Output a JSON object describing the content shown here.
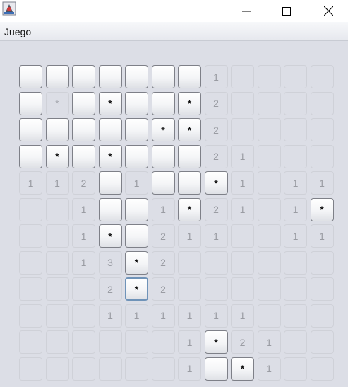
{
  "window": {
    "icon": "minesweeper-app-icon",
    "controls": {
      "minimize_icon": "minimize-icon",
      "maximize_icon": "maximize-icon",
      "close_icon": "close-icon"
    }
  },
  "menu": {
    "items": [
      {
        "label": "Juego"
      }
    ]
  },
  "board": {
    "rows": 12,
    "cols": 12,
    "focused_cell": [
      8,
      4
    ],
    "grid": [
      [
        "B",
        "B",
        "B",
        "B",
        "B",
        "B",
        "B",
        "1",
        "",
        "",
        "",
        ""
      ],
      [
        "B",
        "o*",
        "B",
        "B*",
        "B",
        "B",
        "B*",
        "2",
        "",
        "",
        "",
        ""
      ],
      [
        "B",
        "B",
        "B",
        "B",
        "B",
        "B*",
        "B*",
        "2",
        "",
        "",
        "",
        ""
      ],
      [
        "B",
        "B*",
        "B",
        "B*",
        "B",
        "B",
        "B",
        "2",
        "1",
        "",
        "",
        ""
      ],
      [
        "1",
        "1",
        "2",
        "B",
        "1",
        "B",
        "B",
        "B*",
        "1",
        "",
        "1",
        "1"
      ],
      [
        "",
        "",
        "1",
        "B",
        "B",
        "1",
        "B*",
        "2",
        "1",
        "",
        "1",
        "B*"
      ],
      [
        "",
        "",
        "1",
        "B*",
        "B",
        "2",
        "1",
        "1",
        "",
        "",
        "1",
        "1"
      ],
      [
        "",
        "",
        "1",
        "3",
        "B*",
        "2",
        "",
        "",
        "",
        "",
        "",
        ""
      ],
      [
        "",
        "",
        "",
        "2",
        "B*",
        "2",
        "",
        "",
        "",
        "",
        "",
        ""
      ],
      [
        "",
        "",
        "",
        "1",
        "1",
        "1",
        "1",
        "1",
        "1",
        "",
        "",
        ""
      ],
      [
        "",
        "",
        "",
        "",
        "",
        "",
        "1",
        "B*",
        "2",
        "1",
        "",
        ""
      ],
      [
        "",
        "",
        "",
        "",
        "",
        "",
        "1",
        "B",
        "B*",
        "1",
        "",
        ""
      ]
    ]
  }
}
